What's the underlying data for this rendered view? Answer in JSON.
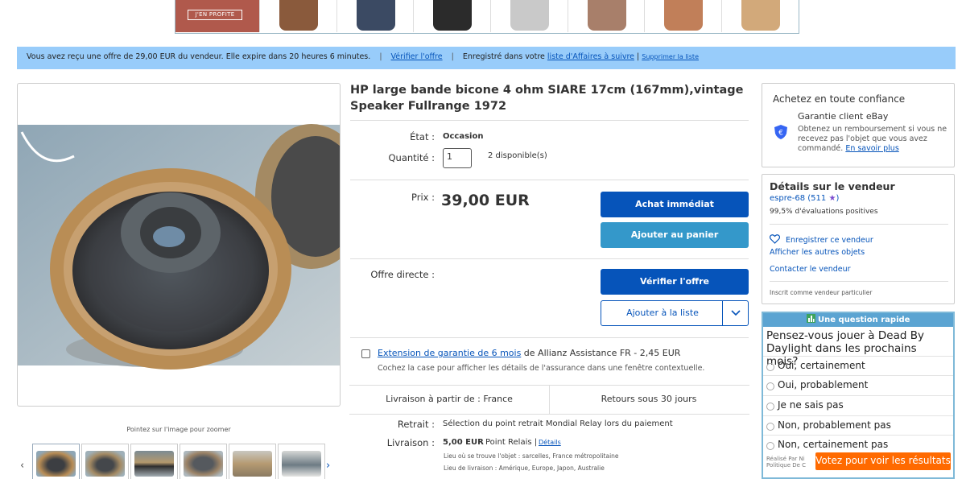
{
  "promo": {
    "cta_label": "J'EN PROFITE",
    "thumb_colors": [
      "#8a5a3c",
      "#3b4a63",
      "#2b2b2b",
      "#c9c9c9",
      "#a87f6a",
      "#c17f59",
      "#d2a97a"
    ]
  },
  "offer_bar": {
    "message": "Vous avez reçu une offre de 29,00 EUR du vendeur. Elle expire dans 20 heures 6 minutes.",
    "verify_link": "Vérifier l'offre",
    "saved_prefix": "Enregistré dans votre ",
    "saved_link": "liste d'Affaires à suivre",
    "remove_link": "Supprimer la liste",
    "sep": "|"
  },
  "gallery": {
    "hint": "Pointez sur l'image pour zoomer",
    "prev_icon": "chevron-left-icon",
    "next_icon": "chevron-right-icon"
  },
  "listing": {
    "title": "HP large bande bicone 4 ohm SIARE 17cm (167mm),vintage Speaker Fullrange 1972",
    "condition_label": "État :",
    "condition_value": "Occasion",
    "quantity_label": "Quantité :",
    "quantity_value": "1",
    "available": "2 disponible(s)",
    "price_label": "Prix :",
    "price": "39,00 EUR",
    "buy_now": "Achat immédiat",
    "add_cart": "Ajouter au panier",
    "offer_label": "Offre directe :",
    "verify_offer": "Vérifier l'offre",
    "add_watchlist": "Ajouter à la liste",
    "warranty_link": "Extension de garantie de 6 mois",
    "warranty_text": " de Allianz Assistance FR - 2,45 EUR",
    "warranty_sub": "Cochez la case pour afficher les détails de l'assurance dans une fenêtre contextuelle.",
    "ships_from": "Livraison à partir de : France",
    "returns": "Retours sous 30 jours",
    "pickup_label": "Retrait :",
    "pickup_value": "Sélection du point retrait Mondial Relay lors du paiement",
    "delivery_label": "Livraison :",
    "delivery_price": "5,00 EUR",
    "delivery_method": "Point Relais |",
    "delivery_details": "Détails",
    "item_location": "Lieu où se trouve l'objet :  sarcelles, France métropolitaine",
    "ships_to": "Lieu de livraison :  Amérique, Europe, Japon, Australie"
  },
  "trust": {
    "title": "Achetez en toute confiance",
    "guarantee_title": "Garantie client eBay",
    "guarantee_text": "Obtenez un remboursement si vous ne recevez pas l'objet que vous avez commandé.",
    "learn_more": "En savoir plus"
  },
  "seller": {
    "title": "Détails sur le vendeur",
    "name": "espre-68",
    "feedback": "(511",
    "feedback_end": ")",
    "positive": "99,5% d'évaluations positives",
    "save_seller": "Enregistrer ce vendeur",
    "other_items": "Afficher les autres objets",
    "contact": "Contacter le vendeur",
    "registered": "Inscrit comme vendeur particulier"
  },
  "survey": {
    "header": "Une question rapide",
    "question": "Pensez-vous jouer à Dead By Daylight dans les prochains mois?",
    "options": [
      "Oui, certainement",
      "Oui, probablement",
      "Je ne sais pas",
      "Non, probablement pas",
      "Non, certainement pas"
    ],
    "vote_button": "Votez pour voir les résultats",
    "footer_1": "Réalisé Par Ni",
    "footer_2": "Politique De C"
  },
  "colors": {
    "primary_button": "#0654ba",
    "secondary_button": "#3498ca",
    "offer_bar": "#98ccfa",
    "vote_button": "#ff6a00"
  }
}
